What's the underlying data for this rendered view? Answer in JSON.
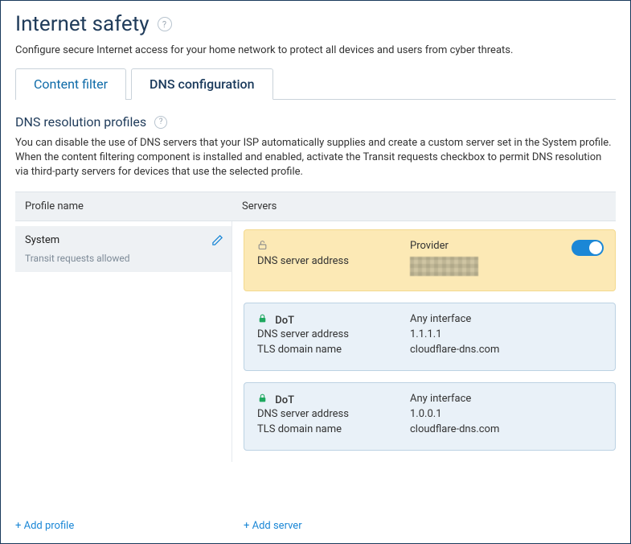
{
  "page": {
    "title": "Internet safety",
    "description": "Configure secure Internet access for your home network to protect all devices and users from cyber threats."
  },
  "tabs": {
    "content_filter": "Content filter",
    "dns_config": "DNS configuration"
  },
  "section": {
    "title": "DNS resolution profiles",
    "description": "You can disable the use of DNS servers that your ISP automatically supplies and create a custom server set in the System profile. When the content filtering component is installed and enabled, activate the Transit requests checkbox to permit DNS resolution via third-party servers for devices that use the selected profile."
  },
  "table": {
    "header_profile": "Profile name",
    "header_servers": "Servers"
  },
  "profile": {
    "name": "System",
    "subtext": "Transit requests allowed"
  },
  "labels": {
    "dns_addr": "DNS server address",
    "tls_domain": "TLS domain name",
    "provider": "Provider",
    "any_iface": "Any interface",
    "dot": "DoT"
  },
  "servers": [
    {
      "proto": "DoT",
      "iface": "Any interface",
      "addr": "1.1.1.1",
      "tls": "cloudflare-dns.com"
    },
    {
      "proto": "DoT",
      "iface": "Any interface",
      "addr": "1.0.0.1",
      "tls": "cloudflare-dns.com"
    }
  ],
  "actions": {
    "add_profile": "+ Add profile",
    "add_server": "+ Add server"
  }
}
